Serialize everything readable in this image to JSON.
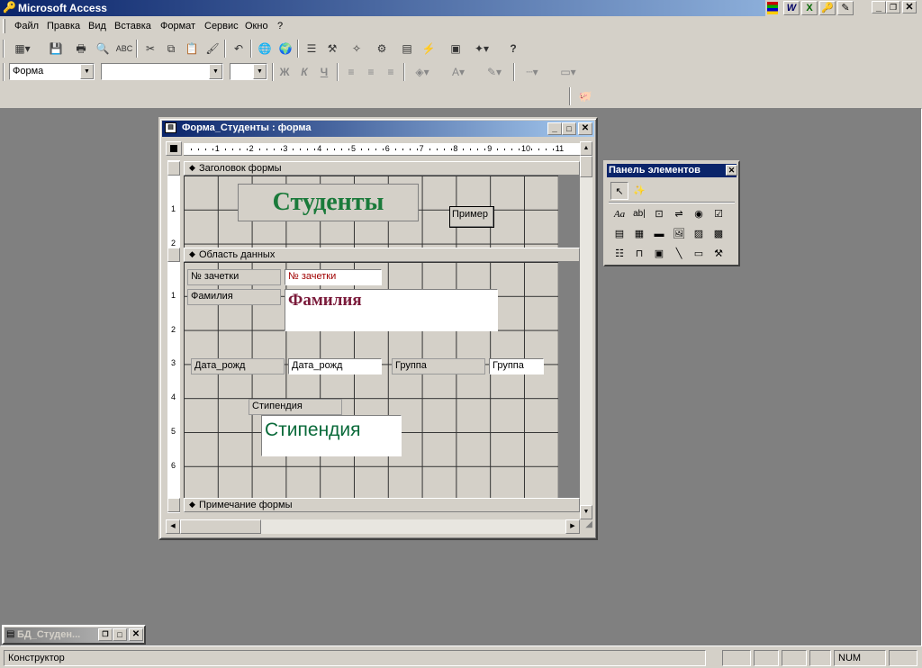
{
  "app": {
    "title": "Microsoft Access"
  },
  "menu": [
    "Файл",
    "Правка",
    "Вид",
    "Вставка",
    "Формат",
    "Сервис",
    "Окно",
    "?"
  ],
  "format_toolbar": {
    "object_combo": "Форма",
    "font_combo": "",
    "size_combo": "",
    "bold": "Ж",
    "italic": "К",
    "underline": "Ч"
  },
  "form_window": {
    "title": "Форма_Студенты : форма",
    "ruler_h": [
      "1",
      "2",
      "3",
      "4",
      "5",
      "6",
      "7",
      "8",
      "9",
      "10",
      "11"
    ],
    "ruler_v_header": [
      "1",
      "2"
    ],
    "ruler_v_detail": [
      "1",
      "2",
      "3",
      "4",
      "5",
      "6"
    ],
    "sections": {
      "header": "Заголовок формы",
      "detail": "Область данных",
      "footer": "Примечание формы"
    },
    "header_title": "Студенты",
    "header_button": "Пример",
    "controls": {
      "zachetka_label": "№ зачетки",
      "zachetka_box": "№ зачетки",
      "familia_label": "Фамилия",
      "familia_box": "Фамилия",
      "data_label": "Дата_рожд",
      "data_box": "Дата_рожд",
      "gruppa_label": "Группа",
      "gruppa_box": "Группа",
      "stip_label": "Стипендия",
      "stip_box": "Стипендия"
    }
  },
  "palette": {
    "title": "Панель элементов"
  },
  "minimized_window": {
    "title": "БД_Студен..."
  },
  "statusbar": {
    "mode": "Конструктор",
    "num": "NUM"
  },
  "colors": {
    "title_green": "#1a7a3a",
    "familia_maroon": "#7a1a3a",
    "stip_green": "#0a6a3a",
    "zachetka_red": "#a00000"
  }
}
